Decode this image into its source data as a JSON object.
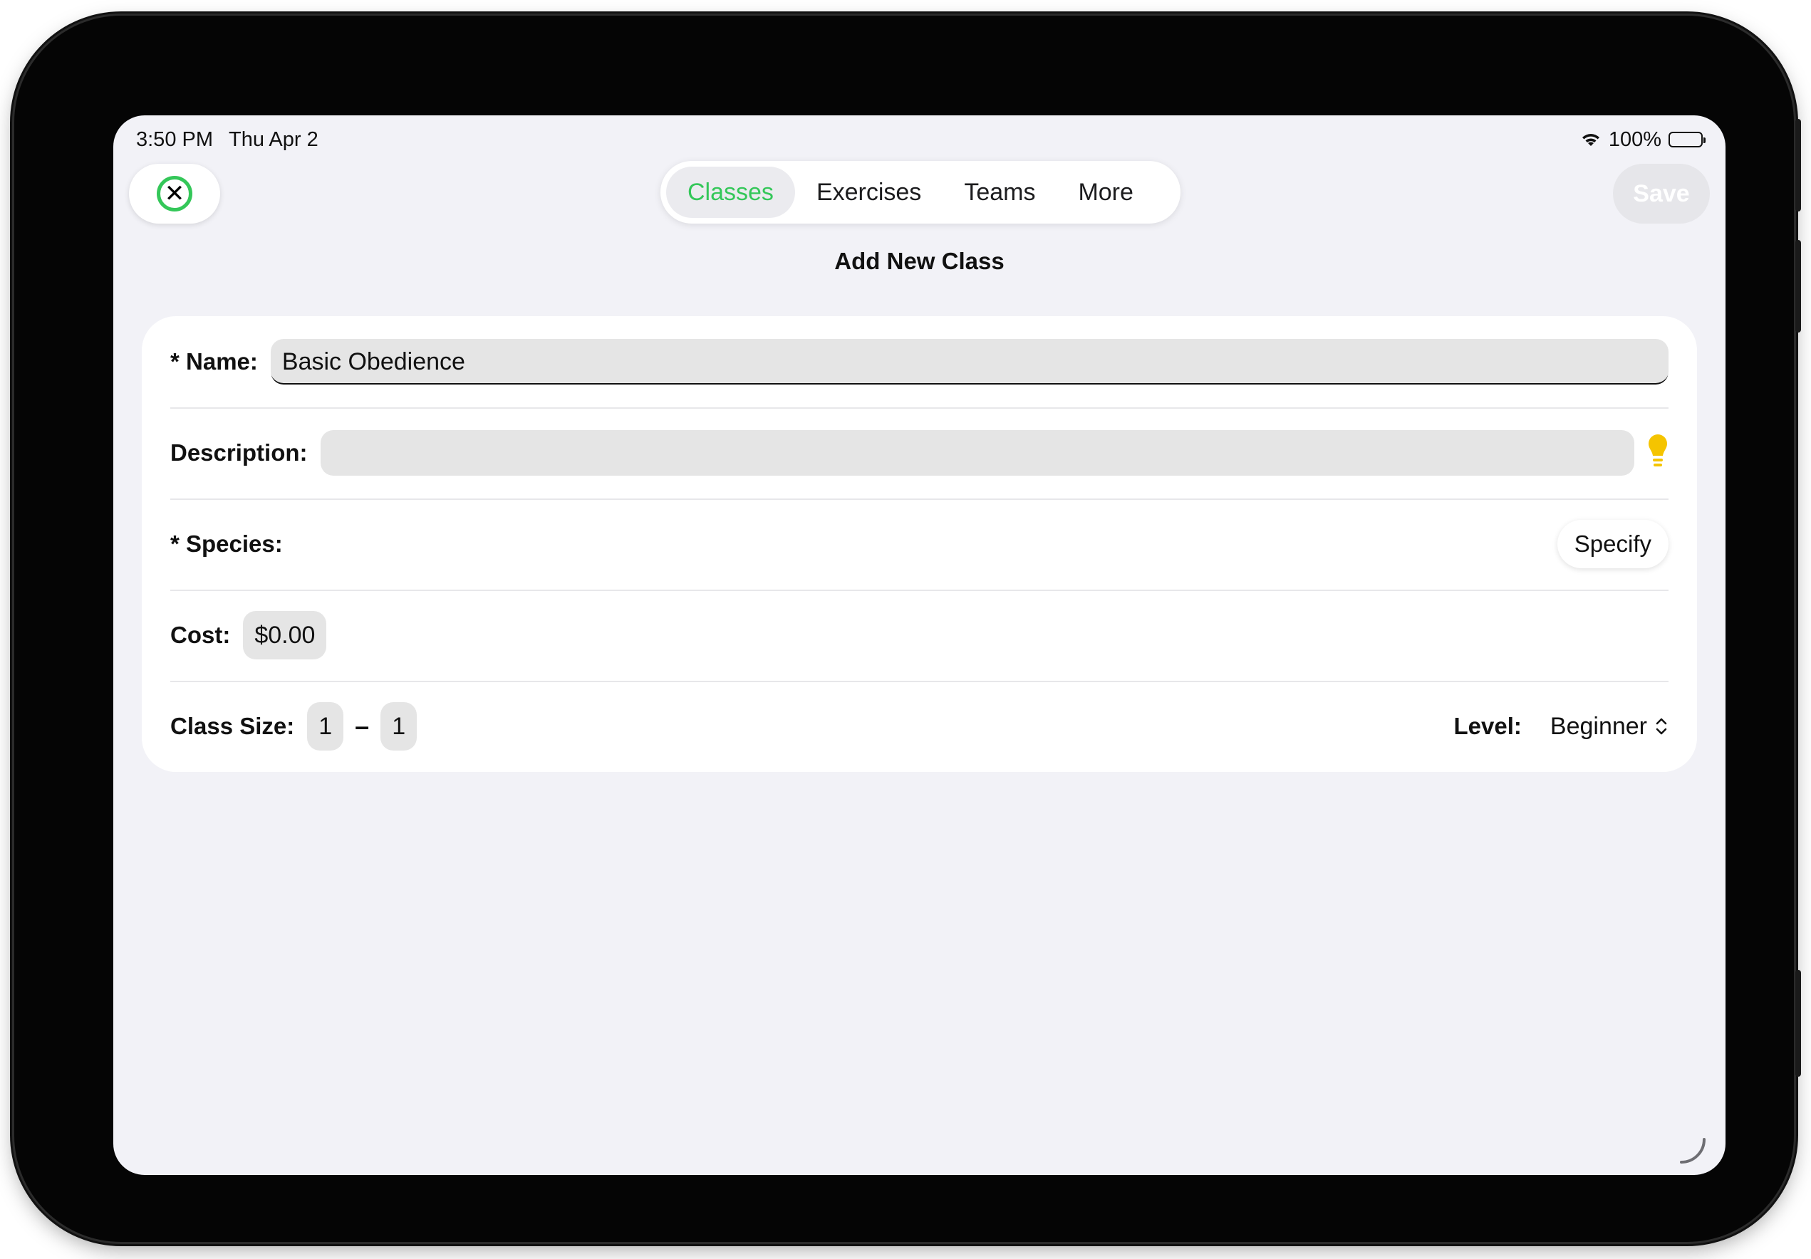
{
  "status_bar": {
    "time": "3:50 PM",
    "date": "Thu Apr 2",
    "battery": "100%"
  },
  "toolbar": {
    "close_icon": "xmark-circle-icon",
    "save_label": "Save",
    "tabs": [
      {
        "label": "Classes",
        "active": true
      },
      {
        "label": "Exercises",
        "active": false
      },
      {
        "label": "Teams",
        "active": false
      },
      {
        "label": "More",
        "active": false
      }
    ]
  },
  "page": {
    "title": "Add New Class"
  },
  "form": {
    "name_label": "* Name:",
    "name_value": "Basic Obedience",
    "description_label": "Description:",
    "description_value": "",
    "description_hint_icon": "lightbulb-icon",
    "species_label": "* Species:",
    "species_button": "Specify",
    "cost_label": "Cost:",
    "cost_value": "$0.00",
    "class_size_label": "Class Size:",
    "class_size_min": "1",
    "class_size_separator": "–",
    "class_size_max": "1",
    "level_label": "Level:",
    "level_value": "Beginner"
  },
  "colors": {
    "accent": "#34c759",
    "background": "#f2f2f7",
    "card": "#ffffff",
    "field": "#e5e5e5",
    "bulb": "#f5c400"
  }
}
